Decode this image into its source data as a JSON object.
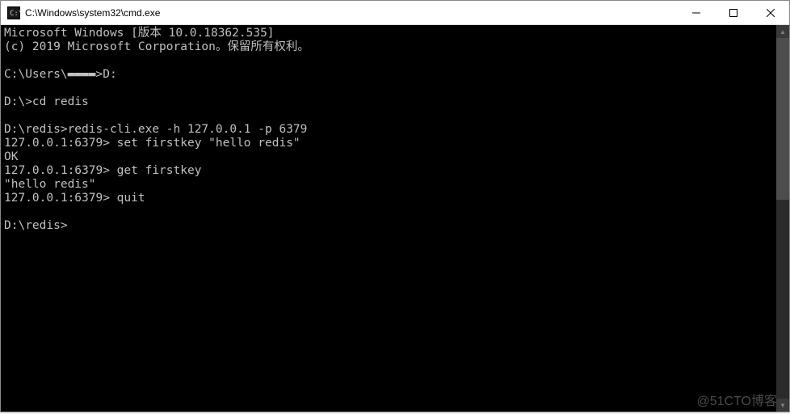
{
  "titlebar": {
    "title": "C:\\Windows\\system32\\cmd.exe"
  },
  "terminal": {
    "lines": [
      "Microsoft Windows [版本 10.0.18362.535]",
      "(c) 2019 Microsoft Corporation。保留所有权利。",
      "",
      "C:\\Users\\▬▬▬▬>D:",
      "",
      "D:\\>cd redis",
      "",
      "D:\\redis>redis-cli.exe -h 127.0.0.1 -p 6379",
      "127.0.0.1:6379> set firstkey \"hello redis\"",
      "OK",
      "127.0.0.1:6379> get firstkey",
      "\"hello redis\"",
      "127.0.0.1:6379> quit",
      "",
      "D:\\redis>"
    ]
  },
  "watermark": "@51CTO博客"
}
